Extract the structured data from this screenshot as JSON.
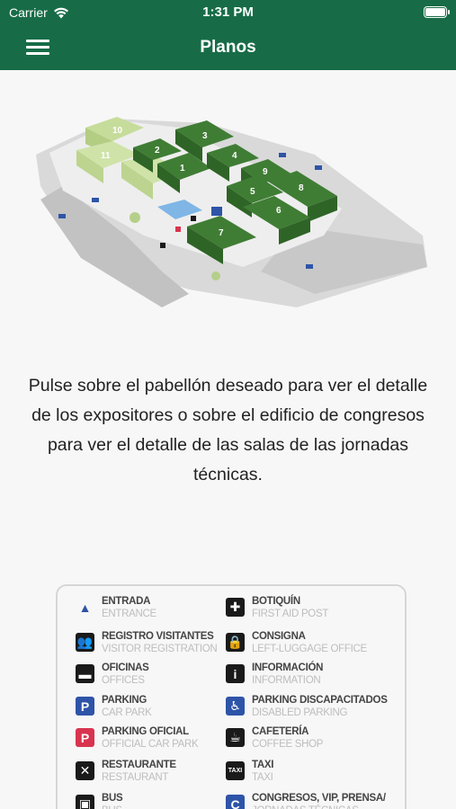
{
  "status_bar": {
    "carrier": "Carrier",
    "time": "1:31 PM"
  },
  "nav": {
    "title": "Planos",
    "menu_icon": "hamburger-menu-icon"
  },
  "map": {
    "halls": [
      "1",
      "2",
      "3",
      "4",
      "5",
      "6",
      "7",
      "8",
      "9",
      "10",
      "11"
    ]
  },
  "instructions": "Pulse sobre el pabellón deseado para ver el detalle de los expositores o sobre el edificio de congresos para ver el detalle de las salas de las jornadas técnicas.",
  "legend": {
    "items": [
      {
        "title": "ENTRADA",
        "subtitle": "ENTRANCE",
        "icon": "entrance-icon",
        "glyph": "▲",
        "color": "#2e54a8"
      },
      {
        "title": "BOTIQUÍN",
        "subtitle": "FIRST AID POST",
        "icon": "first-aid-icon",
        "glyph": "✚",
        "color": "#1a1a1a"
      },
      {
        "title": "REGISTRO VISITANTES",
        "subtitle": "VISITOR REGISTRATION",
        "icon": "registration-icon",
        "glyph": "👥",
        "color": "#1a1a1a"
      },
      {
        "title": "CONSIGNA",
        "subtitle": "LEFT-LUGGAGE OFFICE",
        "icon": "luggage-icon",
        "glyph": "🔒",
        "color": "#1a1a1a"
      },
      {
        "title": "OFICINAS",
        "subtitle": "OFFICES",
        "icon": "office-icon",
        "glyph": "▬",
        "color": "#1a1a1a"
      },
      {
        "title": "INFORMACIÓN",
        "subtitle": "INFORMATION",
        "icon": "information-icon",
        "glyph": "i",
        "color": "#1a1a1a"
      },
      {
        "title": "PARKING",
        "subtitle": "CAR PARK",
        "icon": "parking-icon",
        "glyph": "P",
        "color": "#2e54a8"
      },
      {
        "title": "PARKING DISCAPACITADOS",
        "subtitle": "DISABLED PARKING",
        "icon": "disabled-parking-icon",
        "glyph": "♿",
        "color": "#2e54a8"
      },
      {
        "title": "PARKING OFICIAL",
        "subtitle": "OFFICIAL CAR PARK",
        "icon": "official-parking-icon",
        "glyph": "P",
        "color": "#d8344f"
      },
      {
        "title": "CAFETERÍA",
        "subtitle": "COFFEE SHOP",
        "icon": "coffee-icon",
        "glyph": "☕",
        "color": "#1a1a1a"
      },
      {
        "title": "RESTAURANTE",
        "subtitle": "RESTAURANT",
        "icon": "restaurant-icon",
        "glyph": "✕",
        "color": "#1a1a1a"
      },
      {
        "title": "TAXI",
        "subtitle": "TAXI",
        "icon": "taxi-icon",
        "glyph": "TAXI",
        "color": "#1a1a1a"
      },
      {
        "title": "BUS",
        "subtitle": "BUS",
        "icon": "bus-icon",
        "glyph": "▣",
        "color": "#1a1a1a"
      },
      {
        "title": "CONGRESOS, VIP, PRENSA/",
        "subtitle": "JORNADAS TÉCNICAS",
        "icon": "congress-icon",
        "glyph": "C",
        "color": "#2e54a8"
      }
    ]
  }
}
